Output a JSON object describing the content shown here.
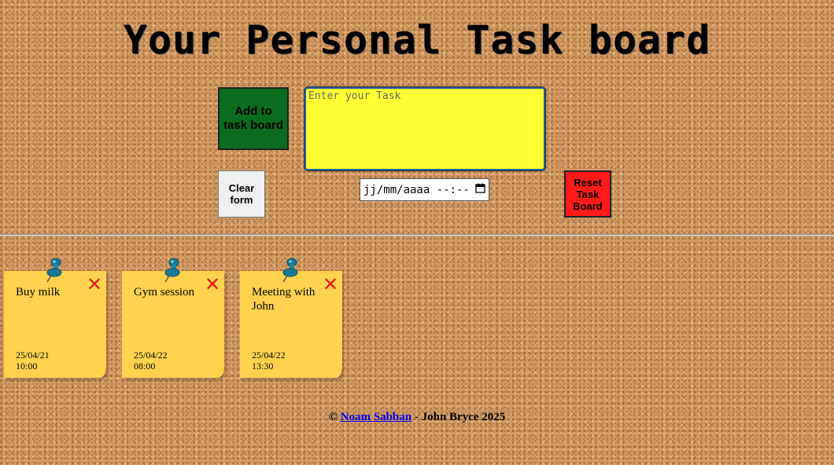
{
  "page": {
    "title": "Your Personal Task board"
  },
  "form": {
    "add_label": "Add to task board",
    "task_placeholder": "Enter your Task",
    "clear_label": "Clear form",
    "date_placeholder": "jj/mm/aaaa --:--",
    "reset_label": "Reset Task Board"
  },
  "notes": [
    {
      "text": "Buy milk",
      "date": "25/04/21",
      "time": "10:00"
    },
    {
      "text": "Gym session",
      "date": "25/04/22",
      "time": "08:00"
    },
    {
      "text": "Meeting with John",
      "date": "25/04/22",
      "time": "13:30"
    }
  ],
  "footer": {
    "copyright": "©",
    "author_link": "Noam Sabban",
    "suffix": "- John Bryce 2025"
  },
  "colors": {
    "add_button": "#0b6b1e",
    "task_input": "#ffff33",
    "reset_button": "#ff1a1a",
    "note": "#ffd34d",
    "close_icon": "#e01b1b",
    "pin": "#1a7a96"
  },
  "icons": {
    "note_close": "close-icon",
    "note_pin": "pushpin-icon",
    "date_picker": "calendar-icon"
  }
}
